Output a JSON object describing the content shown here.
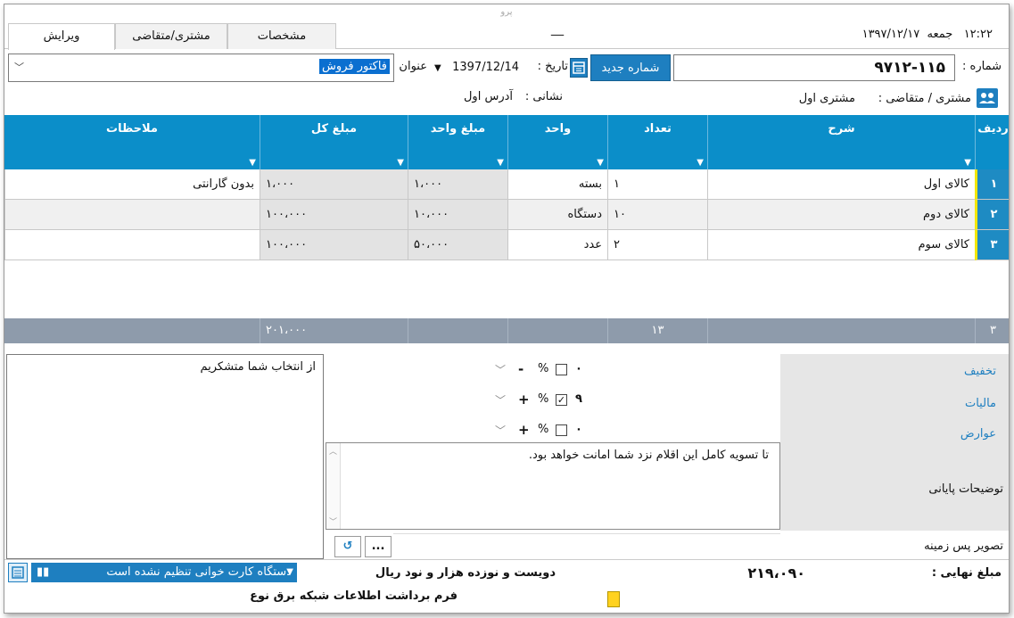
{
  "window_title": "پرو",
  "tabs": [
    {
      "label": "ویرایش",
      "active": true
    },
    {
      "label": "مشتری/متقاضی",
      "active": false
    },
    {
      "label": "مشخصات",
      "active": false
    }
  ],
  "clock": {
    "time": "۱۲:۲۲",
    "day": "جمعه",
    "date": "۱۳۹۷/۱۲/۱۷"
  },
  "dash": "—",
  "header": {
    "number_label": "شماره :",
    "number_value": "۹۷۱۲-۱۱۵",
    "new_number_button": "شماره جدید",
    "date_label": "تاریخ :",
    "date_value": "1397/12/14",
    "title_label": "عنوان :",
    "title_value": "فاکتور فروش"
  },
  "customer": {
    "label": "مشتری / متقاضی :",
    "value": "مشتری اول",
    "address_label": "نشانی :",
    "address_value": "آدرس اول"
  },
  "grid": {
    "columns": [
      "ردیف",
      "شرح",
      "تعداد",
      "واحد",
      "مبلغ واحد",
      "مبلغ کل",
      "ملاحظات"
    ],
    "rows": [
      {
        "row": "۱",
        "desc": "کالای اول",
        "qty": "۱",
        "unit": "بسته",
        "unit_price": "۱،۰۰۰",
        "total": "۱،۰۰۰",
        "note": "بدون گارانتی"
      },
      {
        "row": "۲",
        "desc": "کالای دوم",
        "qty": "۱۰",
        "unit": "دستگاه",
        "unit_price": "۱۰،۰۰۰",
        "total": "۱۰۰،۰۰۰",
        "note": ""
      },
      {
        "row": "۳",
        "desc": "کالای سوم",
        "qty": "۲",
        "unit": "عدد",
        "unit_price": "۵۰،۰۰۰",
        "total": "۱۰۰،۰۰۰",
        "note": ""
      }
    ],
    "footer": {
      "row_count": "۳",
      "qty_sum": "۱۳",
      "total_sum": "۲۰۱،۰۰۰"
    }
  },
  "adjustments": {
    "discount": {
      "label": "تخفیف",
      "value": "۰",
      "sign": "-",
      "checked": false
    },
    "tax": {
      "label": "مالیات",
      "value": "۹",
      "sign": "+",
      "checked": true
    },
    "duties": {
      "label": "عوارض",
      "value": "۰",
      "sign": "+",
      "checked": false
    },
    "percent": "%"
  },
  "thanks_note": "از انتخاب شما متشکریم",
  "footer_desc": {
    "label": "توضیحات پایانی",
    "text": "تا تسویه کامل این اقلام نزد شما امانت خواهد بود."
  },
  "background": {
    "label": "تصویر پس زمینه",
    "browse": "...",
    "reset": "↺"
  },
  "final": {
    "label": "مبلغ نهایی :",
    "value": "۲۱۹،۰۹۰",
    "words": "دویست و نوزده هزار و نود ریال"
  },
  "card_reader": "دستگاه کارت خوانی تنظیم نشده است",
  "bottom_strip": "فرم برداشت اطلاعات شبکه برق نوع",
  "colors": {
    "accent": "#1e7fc0",
    "grid_header": "#0b8ec9",
    "grid_footer": "#8e9bab"
  }
}
